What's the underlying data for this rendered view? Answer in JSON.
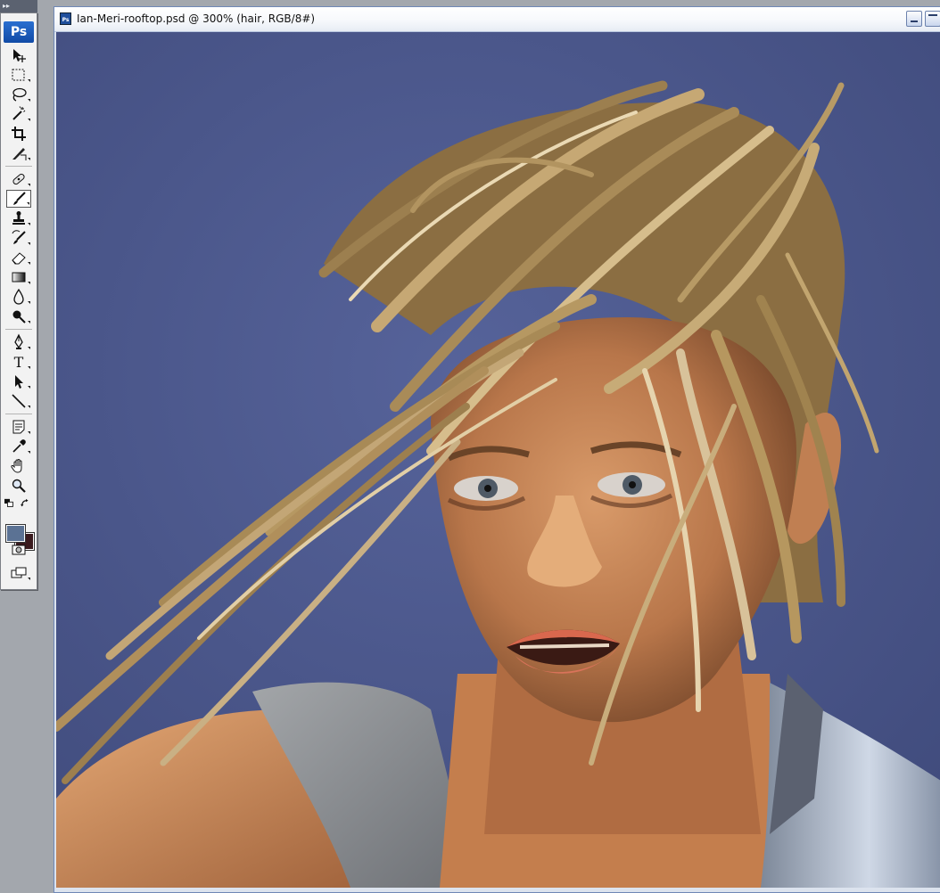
{
  "app": {
    "logo": "Ps"
  },
  "toolbox": {
    "grip": "▸▸",
    "tools": [
      {
        "name": "move-tool-icon"
      },
      {
        "name": "marquee-tool-icon"
      },
      {
        "name": "lasso-tool-icon"
      },
      {
        "name": "magic-wand-tool-icon"
      },
      {
        "name": "crop-tool-icon"
      },
      {
        "name": "slice-tool-icon"
      },
      {
        "name": "healing-brush-tool-icon"
      },
      {
        "name": "brush-tool-icon",
        "active": true
      },
      {
        "name": "clone-stamp-tool-icon"
      },
      {
        "name": "history-brush-tool-icon"
      },
      {
        "name": "eraser-tool-icon"
      },
      {
        "name": "gradient-tool-icon"
      },
      {
        "name": "blur-tool-icon"
      },
      {
        "name": "dodge-tool-icon"
      },
      {
        "name": "pen-tool-icon"
      },
      {
        "name": "type-tool-icon"
      },
      {
        "name": "path-selection-tool-icon"
      },
      {
        "name": "line-tool-icon"
      },
      {
        "name": "notes-tool-icon"
      },
      {
        "name": "eyedropper-tool-icon"
      },
      {
        "name": "hand-tool-icon"
      },
      {
        "name": "zoom-tool-icon"
      }
    ],
    "foreground_color": "#5b7294",
    "background_color": "#3a1a1e",
    "type_tool_glyph": "T"
  },
  "document": {
    "title": "Ian-Meri-rooftop.psd @ 300% (hair, RGB/8#)",
    "icon_label": "Ps",
    "zoom": "300%",
    "layer": "hair",
    "mode": "RGB/8#"
  },
  "canvas": {
    "backdrop_color": "#4a5688",
    "skin_color": "#c98a5a",
    "hair_color": "#b99a62",
    "shirt_color": "#8b8f94"
  }
}
